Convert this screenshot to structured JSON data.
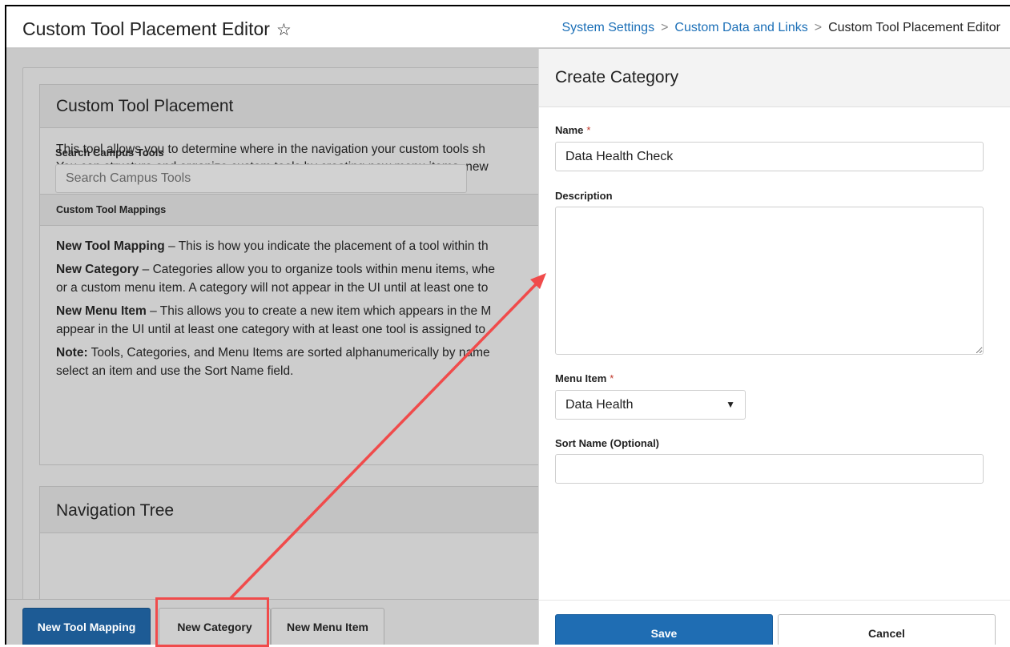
{
  "header": {
    "title": "Custom Tool Placement Editor",
    "star_icon": "star-icon",
    "breadcrumb": {
      "item1": "System Settings",
      "item2": "Custom Data and Links",
      "current": "Custom Tool Placement Editor",
      "separator": ">"
    }
  },
  "main": {
    "placement_card": {
      "title": "Custom Tool Placement",
      "description_line1": "This tool allows you to determine where in the navigation your custom tools sh",
      "description_line2": "You can structure and organize custom tools by creating new menu items, new",
      "mappings_heading": "Custom Tool Mappings",
      "tool_mapping_term": "New Tool Mapping",
      "tool_mapping_text": " – This is how you indicate the placement of a tool within th",
      "category_term": "New Category",
      "category_text_1": " – Categories allow you to organize tools within menu items, whe",
      "category_text_2": "or a custom menu item. A category will not appear in the UI until at least one to",
      "menu_item_term": "New Menu Item",
      "menu_item_text_1": " – This allows you to create a new item which appears in the M",
      "menu_item_text_2": "appear in the UI until at least one category with at least one tool is assigned to",
      "note_term": "Note:",
      "note_text_1": " Tools, Categories, and Menu Items are sorted alphanumerically by name",
      "note_text_2": "select an item and use the Sort Name field."
    },
    "navigation_card": {
      "title": "Navigation Tree",
      "search_label": "Search Campus Tools",
      "search_placeholder": "Search Campus Tools"
    }
  },
  "toolbar": {
    "new_tool_mapping": "New Tool Mapping",
    "new_category": "New Category",
    "new_menu_item": "New Menu Item"
  },
  "panel": {
    "title": "Create Category",
    "name_label": "Name",
    "name_value": "Data Health Check",
    "required_marker": "*",
    "description_label": "Description",
    "description_value": "",
    "menu_item_label": "Menu Item",
    "menu_item_value": "Data Health",
    "sort_name_label": "Sort Name (Optional)",
    "sort_name_value": "",
    "save_label": "Save",
    "cancel_label": "Cancel",
    "caret_icon": "caret-down-icon"
  },
  "annotation": {
    "color": "#f04b4b"
  }
}
